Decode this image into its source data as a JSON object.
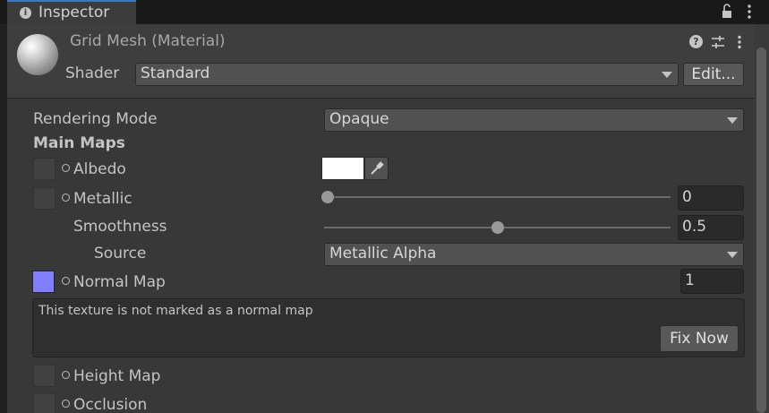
{
  "window": {
    "tab_label": "Inspector"
  },
  "material": {
    "title": "Grid Mesh (Material)",
    "shader_label": "Shader",
    "shader_value": "Standard",
    "edit_button": "Edit..."
  },
  "properties": {
    "rendering_mode_label": "Rendering Mode",
    "rendering_mode_value": "Opaque",
    "main_maps_header": "Main Maps",
    "albedo_label": "Albedo",
    "albedo_color": "#ffffff",
    "metallic_label": "Metallic",
    "metallic_value": "0",
    "metallic_fraction": 0,
    "smoothness_label": "Smoothness",
    "smoothness_value": "0.5",
    "smoothness_fraction": 0.5,
    "source_label": "Source",
    "source_value": "Metallic Alpha",
    "normal_map_label": "Normal Map",
    "normal_map_value": "1",
    "normal_map_color": "#8080ff",
    "height_map_label": "Height Map",
    "occlusion_label": "Occlusion"
  },
  "helpbox": {
    "message": "This texture is not marked as a normal map",
    "fix_button": "Fix Now"
  },
  "icons": {
    "tab": "info-icon",
    "lock": "lock-icon",
    "menu": "kebab-menu-icon",
    "help": "help-icon",
    "presets": "presets-icon",
    "picker": "eyedropper-icon"
  }
}
